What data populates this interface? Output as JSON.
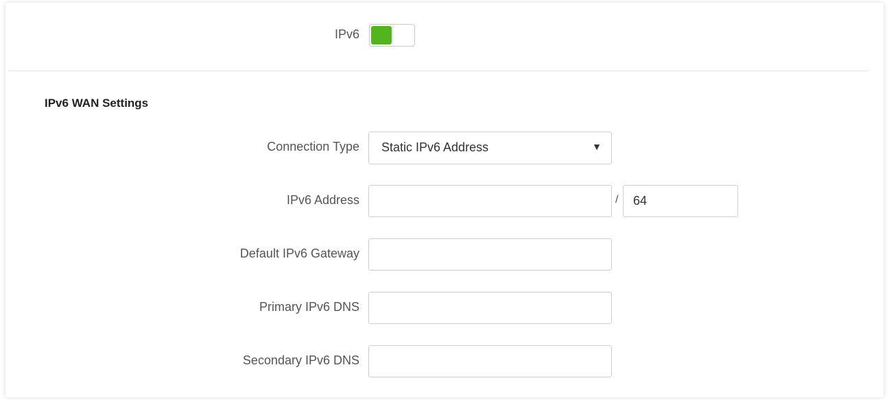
{
  "ipv6_toggle": {
    "label": "IPv6",
    "enabled": true,
    "on_color": "#52b51d"
  },
  "section": {
    "title": "IPv6 WAN Settings"
  },
  "connection_type": {
    "label": "Connection Type",
    "value": "Static IPv6 Address",
    "arrow_icon": "triangle-down-icon"
  },
  "ipv6_address": {
    "label": "IPv6 Address",
    "value": "",
    "separator": "/",
    "prefix_length": "64"
  },
  "default_gateway": {
    "label": "Default IPv6 Gateway",
    "value": ""
  },
  "primary_dns": {
    "label": "Primary IPv6 DNS",
    "value": ""
  },
  "secondary_dns": {
    "label": "Secondary IPv6 DNS",
    "value": ""
  }
}
